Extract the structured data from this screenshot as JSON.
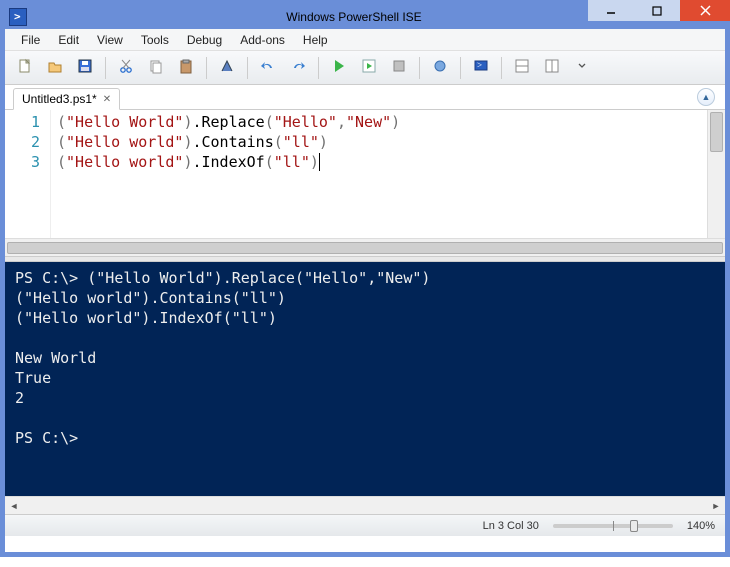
{
  "window": {
    "title": "Windows PowerShell ISE"
  },
  "menu": [
    "File",
    "Edit",
    "View",
    "Tools",
    "Debug",
    "Add-ons",
    "Help"
  ],
  "toolbar_icons": [
    "new-file",
    "open-file",
    "save",
    "",
    "cut",
    "copy",
    "paste",
    "",
    "clear",
    "",
    "undo",
    "redo",
    "",
    "run",
    "run-selection",
    "stop",
    "",
    "breakpoint",
    "",
    "remote",
    "",
    "layout-horizontal",
    "layout-panes",
    "more"
  ],
  "tab": {
    "label": "Untitled3.ps1*"
  },
  "code": {
    "lines": [
      {
        "n": "1",
        "tokens": [
          {
            "t": "(",
            "c": "op"
          },
          {
            "t": "\"Hello World\"",
            "c": "str"
          },
          {
            "t": ")",
            "c": "op"
          },
          {
            "t": ".",
            "c": "dot"
          },
          {
            "t": "Replace",
            "c": "dot"
          },
          {
            "t": "(",
            "c": "op"
          },
          {
            "t": "\"Hello\"",
            "c": "str"
          },
          {
            "t": ",",
            "c": "op"
          },
          {
            "t": "\"New\"",
            "c": "str"
          },
          {
            "t": ")",
            "c": "op"
          }
        ]
      },
      {
        "n": "2",
        "tokens": [
          {
            "t": "(",
            "c": "op"
          },
          {
            "t": "\"Hello world\"",
            "c": "str"
          },
          {
            "t": ")",
            "c": "op"
          },
          {
            "t": ".",
            "c": "dot"
          },
          {
            "t": "Contains",
            "c": "dot"
          },
          {
            "t": "(",
            "c": "op"
          },
          {
            "t": "\"ll\"",
            "c": "str"
          },
          {
            "t": ")",
            "c": "op"
          }
        ]
      },
      {
        "n": "3",
        "tokens": [
          {
            "t": "(",
            "c": "op"
          },
          {
            "t": "\"Hello world\"",
            "c": "str"
          },
          {
            "t": ")",
            "c": "op"
          },
          {
            "t": ".",
            "c": "dot"
          },
          {
            "t": "IndexOf",
            "c": "dot"
          },
          {
            "t": "(",
            "c": "op"
          },
          {
            "t": "\"ll\"",
            "c": "str"
          },
          {
            "t": ")",
            "c": "op"
          }
        ],
        "cursor": true
      }
    ]
  },
  "console": {
    "lines": [
      "PS C:\\> (\"Hello World\").Replace(\"Hello\",\"New\")",
      "(\"Hello world\").Contains(\"ll\")",
      "(\"Hello world\").IndexOf(\"ll\")",
      "",
      "New World",
      "True",
      "2",
      "",
      "PS C:\\>"
    ]
  },
  "status": {
    "pos": "Ln 3  Col 30",
    "zoom": "140%",
    "zoom_thumb_pct": 64
  }
}
